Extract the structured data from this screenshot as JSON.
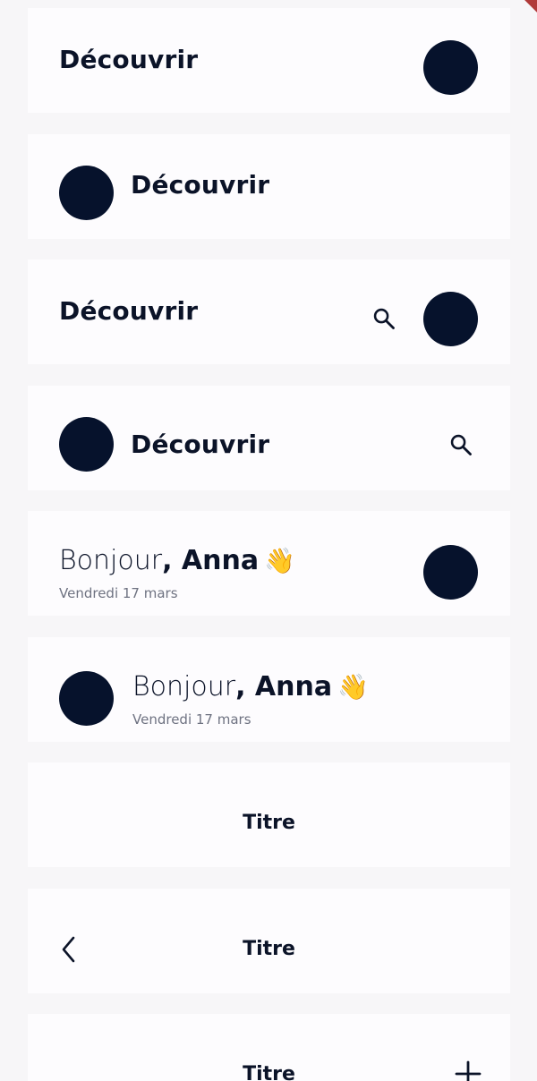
{
  "cards": {
    "card1": {
      "title": "Découvrir"
    },
    "card2": {
      "title": "Découvrir"
    },
    "card3": {
      "title": "Découvrir"
    },
    "card4": {
      "title": "Découvrir"
    },
    "card5": {
      "greeting": "Bonjour",
      "name": ", Anna",
      "emoji": "👋",
      "date": "Vendredi 17 mars"
    },
    "card6": {
      "greeting": "Bonjour",
      "name": ", Anna",
      "emoji": "👋",
      "date": "Vendredi 17 mars"
    },
    "card7": {
      "title": "Titre"
    },
    "card8": {
      "title": "Titre"
    },
    "card9": {
      "title": "Titre"
    }
  },
  "icons": {
    "search": "search-icon",
    "back": "chevron-left-icon",
    "add": "plus-icon"
  },
  "colors": {
    "background": "#f7f6f8",
    "card": "#fdfcfe",
    "avatar": "#06122c",
    "text": "#0b1328",
    "muted": "#6e7281",
    "debug_banner": "#b03a3a"
  }
}
